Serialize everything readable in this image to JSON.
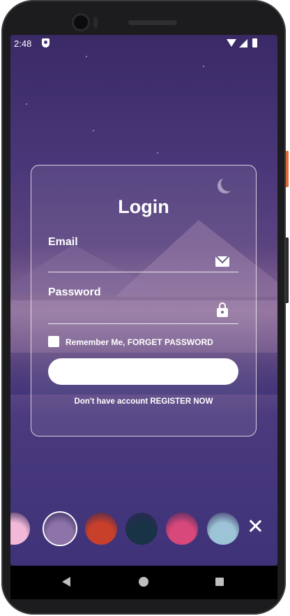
{
  "status_bar": {
    "time": "2:48",
    "icons": [
      "shield-icon",
      "wifi-icon",
      "signal-icon",
      "battery-icon"
    ]
  },
  "login": {
    "title": "Login",
    "email_label": "Email",
    "email_value": "",
    "password_label": "Password",
    "password_value": "",
    "remember_text": "Remember Me, FORGET PASSWORD",
    "login_button_label": "",
    "register_text": "Don't have account REGISTER NOW"
  },
  "theme_picker": {
    "selected_index": 1,
    "themes": [
      {
        "name": "pink-clouds",
        "color": "#f2b8d8"
      },
      {
        "name": "purple-mountains",
        "color": "#8d73a8"
      },
      {
        "name": "red-sunset",
        "color": "#c8402a"
      },
      {
        "name": "dark-peaks",
        "color": "#183246"
      },
      {
        "name": "pink-desert",
        "color": "#d8487a"
      },
      {
        "name": "ice-cave",
        "color": "#9cc4d6"
      }
    ]
  },
  "colors": {
    "background_top": "#3a2a66",
    "card_border": "#ffffff",
    "text": "#ffffff"
  }
}
